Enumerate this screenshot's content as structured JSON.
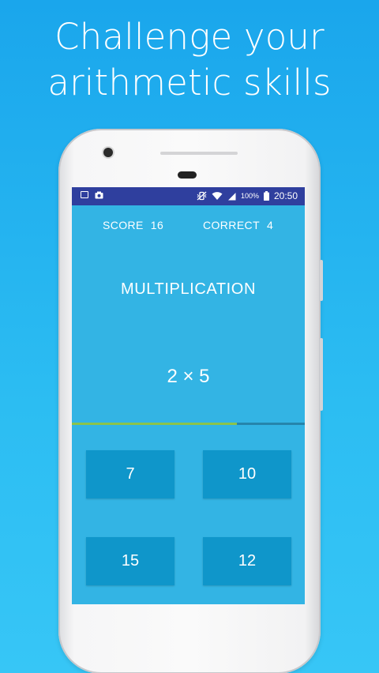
{
  "headline": {
    "line1": "Challenge your",
    "line2": "arithmetic skills"
  },
  "statusbar": {
    "battery": "100%",
    "time": "20:50",
    "icons": [
      "image-icon",
      "camera-icon",
      "vibrate-mute-icon",
      "wifi-icon",
      "cell-signal-icon",
      "battery-icon"
    ]
  },
  "game": {
    "score_label": "SCORE",
    "score_value": "16",
    "correct_label": "CORRECT",
    "correct_value": "4",
    "category": "MULTIPLICATION",
    "question": "2 × 5",
    "timer_fraction": 0.71,
    "answers": [
      "7",
      "10",
      "15",
      "12"
    ]
  },
  "colors": {
    "background_top": "#1aa6ec",
    "screen": "#33b4e4",
    "statusbar": "#2f3f9e",
    "answer_button": "#0f96ca",
    "progress_fill": "#8bc34a"
  }
}
